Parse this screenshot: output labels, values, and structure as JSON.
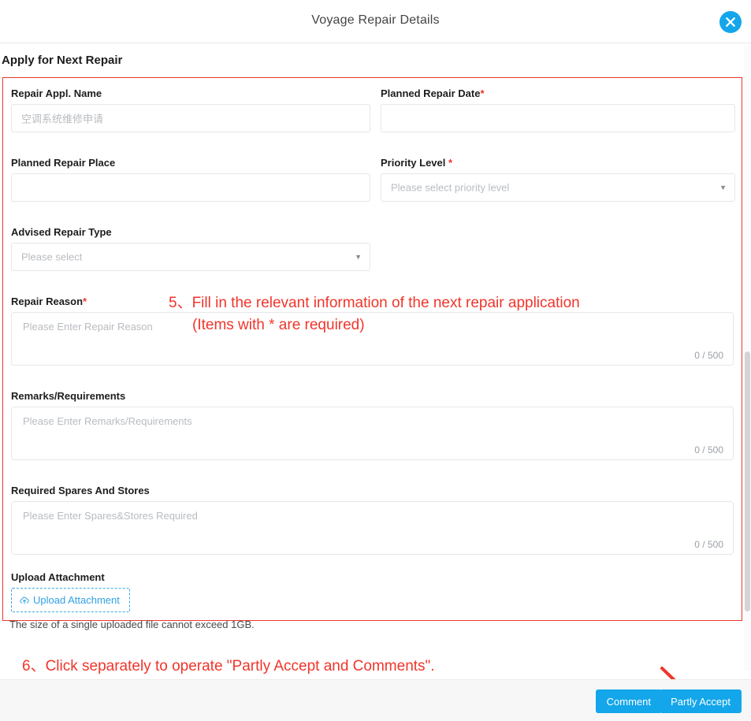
{
  "modal": {
    "title": "Voyage Repair Details",
    "close_icon": "close-icon"
  },
  "section": {
    "title": "Apply for Next Repair"
  },
  "form": {
    "repair_appl_name": {
      "label": "Repair Appl. Name",
      "placeholder": "空调系统维修申请",
      "value": ""
    },
    "planned_repair_date": {
      "label": "Planned Repair Date",
      "required_mark": "*",
      "placeholder": "",
      "value": ""
    },
    "planned_repair_place": {
      "label": "Planned Repair Place",
      "placeholder": "",
      "value": ""
    },
    "priority_level": {
      "label": "Priority Level ",
      "required_mark": "*",
      "selected": "Please select priority level",
      "caret_icon": "chevron-down-icon"
    },
    "advised_repair_type": {
      "label": "Advised Repair Type",
      "selected": "Please select",
      "caret_icon": "chevron-down-icon"
    },
    "repair_reason": {
      "label": "Repair Reason",
      "required_mark": "*",
      "placeholder": "Please Enter Repair Reason",
      "counter": "0 / 500"
    },
    "remarks": {
      "label": "Remarks/Requirements",
      "placeholder": "Please Enter Remarks/Requirements",
      "counter": "0 / 500"
    },
    "spares": {
      "label": "Required Spares And Stores",
      "placeholder": "Please Enter Spares&Stores Required",
      "counter": "0 / 500"
    },
    "upload": {
      "label": "Upload Attachment",
      "button_label": "Upload Attachment",
      "icon": "cloud-upload-icon",
      "hint": "The size of a single uploaded file cannot exceed 1GB."
    }
  },
  "annotations": {
    "step5_line1": "5、Fill in the relevant information of the next repair application",
    "step5_line2": "(Items with * are required)",
    "step6": "6、Click separately to operate \"Partly Accept and Comments\"."
  },
  "footer": {
    "comment_label": "Comment",
    "partly_accept_label": "Partly Accept"
  },
  "colors": {
    "accent": "#14a6ea",
    "annotation_red": "#f0352b",
    "required_red": "#e8392e",
    "border_red": "#e8392e"
  }
}
